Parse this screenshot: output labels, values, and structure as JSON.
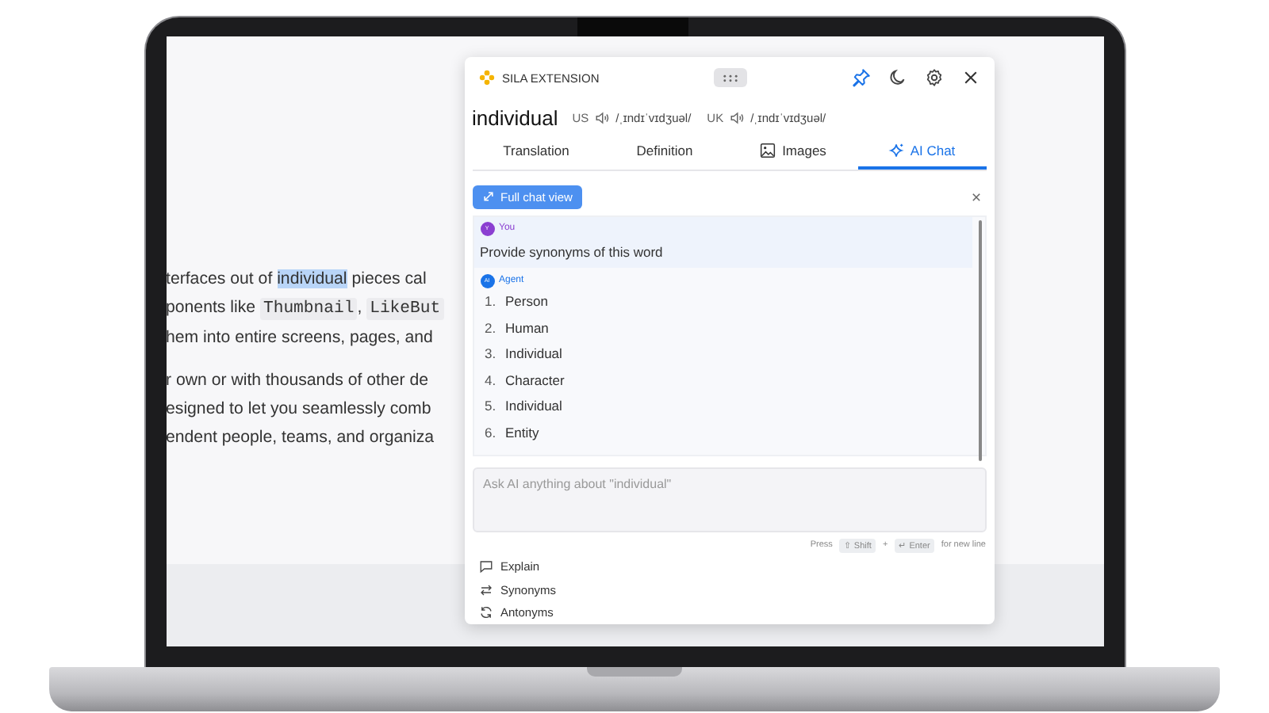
{
  "page": {
    "paragraphs": [
      {
        "lines": [
          [
            {
              "kind": "text",
              "text": "terfaces out of "
            },
            {
              "kind": "highlight",
              "text": "individual"
            },
            {
              "kind": "text",
              "text": " pieces cal"
            }
          ],
          [
            {
              "kind": "text",
              "text": "ponents like "
            },
            {
              "kind": "code",
              "text": "Thumbnail"
            },
            {
              "kind": "text",
              "text": ", "
            },
            {
              "kind": "code",
              "text": "LikeBut"
            }
          ],
          [
            {
              "kind": "text",
              "text": "hem into entire screens, pages, and"
            }
          ]
        ]
      },
      {
        "lines": [
          [
            {
              "kind": "text",
              "text": "r own or with thousands of other de"
            }
          ],
          [
            {
              "kind": "text",
              "text": "esigned to let you seamlessly comb"
            }
          ],
          [
            {
              "kind": "text",
              "text": "endent people, teams, and organiza"
            }
          ]
        ]
      }
    ]
  },
  "extension": {
    "brand": "SILA EXTENSION",
    "pinned": true,
    "word": "individual",
    "pronunciations": [
      {
        "region": "US",
        "ipa": "/ˌɪndɪˈvɪdʒuəl/"
      },
      {
        "region": "UK",
        "ipa": "/ˌɪndɪˈvɪdʒuəl/"
      }
    ],
    "tabs": [
      {
        "label": "Translation",
        "kind": "plain",
        "selected": false
      },
      {
        "label": "Definition",
        "kind": "plain",
        "selected": false
      },
      {
        "label": "Images",
        "kind": "image",
        "selected": false
      },
      {
        "label": "AI Chat",
        "kind": "sparkle",
        "selected": true
      }
    ],
    "chat": {
      "full_view_label": "Full chat view",
      "messages": [
        {
          "kind": "user",
          "avatar": "Y",
          "author": "You",
          "text": "Provide synonyms of this word"
        },
        {
          "kind": "agent",
          "avatar": "AI",
          "author": "Agent",
          "items": [
            {
              "number": "1.",
              "text": "Person"
            },
            {
              "number": "2.",
              "text": "Human"
            },
            {
              "number": "3.",
              "text": "Individual"
            },
            {
              "number": "4.",
              "text": "Character"
            },
            {
              "number": "5.",
              "text": "Individual"
            },
            {
              "number": "6.",
              "text": "Entity"
            }
          ]
        }
      ],
      "input": {
        "placeholder": "Ask AI anything about \"individual\""
      },
      "hint": {
        "prefix": "Press",
        "keys": [
          "⇧ Shift",
          "↵ Enter"
        ],
        "joiner": "+",
        "suffix": "for new line"
      }
    },
    "actions": [
      {
        "kind": "comment",
        "label": "Explain"
      },
      {
        "kind": "swap",
        "label": "Synonyms"
      },
      {
        "kind": "cycle",
        "label": "Antonyms"
      }
    ]
  }
}
